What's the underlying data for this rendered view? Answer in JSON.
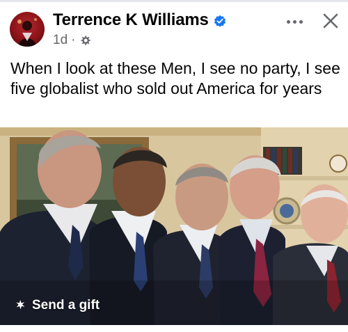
{
  "post": {
    "author_name": "Terrence K Williams",
    "timestamp": "1d",
    "separator": "·",
    "text": "When I look at these Men, I see no party, I see five globalist who sold out America for years",
    "send_gift_label": "Send a gift"
  },
  "icons": {
    "verified": "verified-badge-icon",
    "privacy": "gear-icon",
    "more": "more-options-icon",
    "close": "close-icon",
    "gift": "gift-sparkle-icon"
  },
  "colors": {
    "verified_blue": "#1877f2",
    "secondary_text": "#65676b",
    "primary_text": "#050505"
  }
}
